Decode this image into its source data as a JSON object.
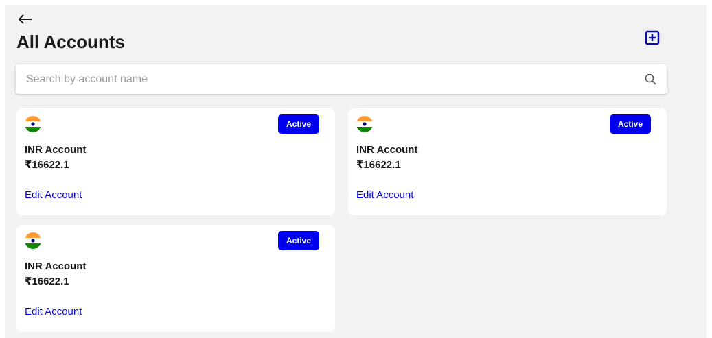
{
  "header": {
    "back_icon": "arrow-left-icon",
    "title": "All Accounts",
    "add_icon": "plus-square-icon"
  },
  "search": {
    "placeholder": "Search by account name",
    "value": "",
    "icon": "search-icon"
  },
  "colors": {
    "accent": "#0000ee",
    "background": "#f2f2f2",
    "card": "#ffffff"
  },
  "accounts": [
    {
      "flag_icon": "india-flag-icon",
      "status": "Active",
      "name": "INR Account",
      "balance": "₹16622.1",
      "edit_label": "Edit Account"
    },
    {
      "flag_icon": "india-flag-icon",
      "status": "Active",
      "name": "INR Account",
      "balance": "₹16622.1",
      "edit_label": "Edit Account"
    },
    {
      "flag_icon": "india-flag-icon",
      "status": "Active",
      "name": "INR Account",
      "balance": "₹16622.1",
      "edit_label": "Edit Account"
    }
  ]
}
